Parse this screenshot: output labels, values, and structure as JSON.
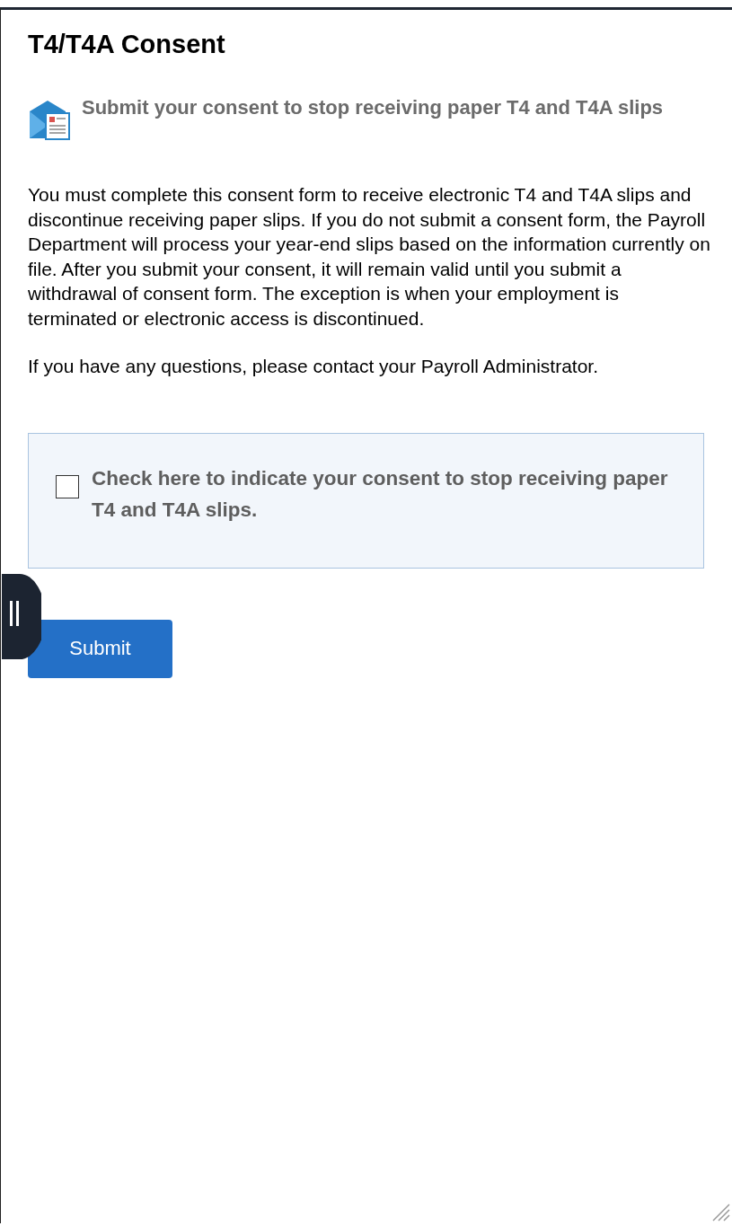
{
  "title": "T4/T4A Consent",
  "subtitle": "Submit your consent to stop receiving paper T4 and T4A slips",
  "paragraphs": [
    "You must complete this consent form to receive electronic T4 and T4A slips and discontinue receiving paper slips. If you do not submit a consent form, the Payroll Department will process your year-end slips based on the information currently on file. After you submit your consent, it will remain valid until you submit a withdrawal of consent form. The exception is when your employment is terminated or electronic access is discontinued.",
    "If you have any questions, please contact your Payroll Administrator."
  ],
  "consent": {
    "label": "Check here to indicate your consent to stop receiving paper T4 and T4A slips.",
    "checked": false
  },
  "buttons": [
    "Submit"
  ]
}
